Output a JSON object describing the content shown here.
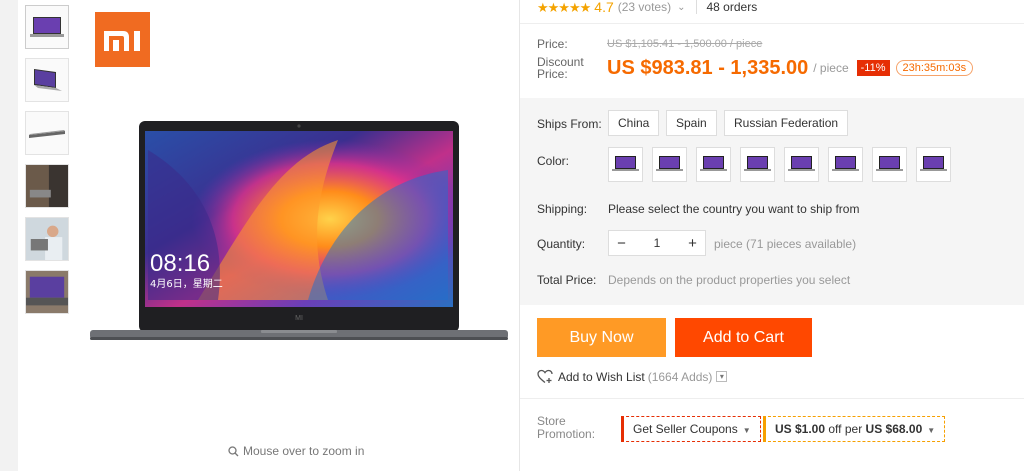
{
  "rating": {
    "stars": "★★★★★",
    "value": "4.7",
    "votes": "(23 votes)",
    "orders": "48 orders"
  },
  "price": {
    "label": "Price:",
    "original": "US $1,105.41 - 1,500.00 / piece",
    "discount_label": "Discount Price:",
    "discount_value": "US $983.81 - 1,335.00",
    "per_piece": "/ piece",
    "off_badge": "-11%",
    "timer": "23h:35m:03s"
  },
  "ships_from": {
    "label": "Ships From:",
    "options": [
      "China",
      "Spain",
      "Russian Federation"
    ]
  },
  "color": {
    "label": "Color:",
    "swatch_count": 8
  },
  "shipping": {
    "label": "Shipping:",
    "text": "Please select the country you want to ship from"
  },
  "quantity": {
    "label": "Quantity:",
    "value": "1",
    "minus": "−",
    "plus": "+",
    "info": "piece (71 pieces available)"
  },
  "total": {
    "label": "Total Price:",
    "text": "Depends on the product properties you select"
  },
  "actions": {
    "buy_now": "Buy Now",
    "add_to_cart": "Add to Cart"
  },
  "wishlist": {
    "label": "Add to Wish List",
    "count": "(1664 Adds)"
  },
  "promotion": {
    "label_line1": "Store",
    "label_line2": "Promotion:",
    "coupon": "Get Seller Coupons",
    "offer_amount": "US $1.00",
    "offer_mid": " off per ",
    "offer_threshold": "US $68.00"
  },
  "gallery": {
    "zoom_hint": "Mouse over to zoom in",
    "screen_time": "08:16",
    "screen_date": "4月6日，星期二",
    "logo_text": "mi",
    "bezel_text": "MI"
  },
  "colors": {
    "accent_orange": "#f66a00",
    "buy_now": "#ff9a25",
    "add_cart": "#ff4800",
    "star": "#f4a300",
    "badge_red": "#e62e04",
    "brand": "#f06b21"
  }
}
